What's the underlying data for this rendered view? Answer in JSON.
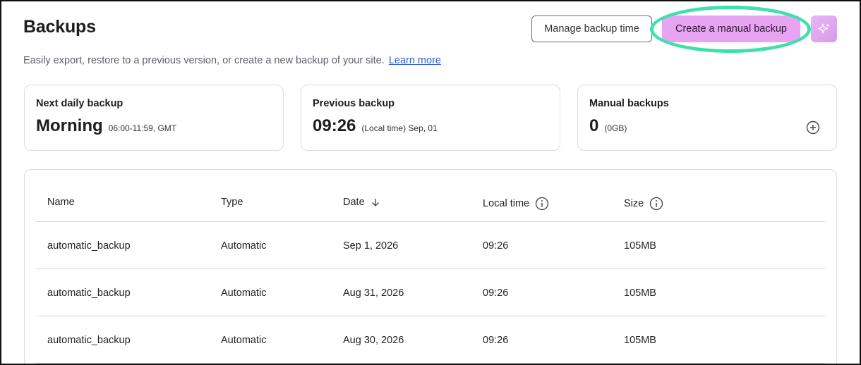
{
  "header": {
    "title": "Backups",
    "subtitle": "Easily export, restore to a previous version, or create a new backup of your site.",
    "learn_more": "Learn more"
  },
  "actions": {
    "manage_label": "Manage backup time",
    "create_label": "Create a manual backup",
    "ai_icon": "sparkles-icon",
    "highlight_color": "#3ee0ad",
    "create_color": "#e7a4f3"
  },
  "cards": {
    "next": {
      "label": "Next daily backup",
      "value": "Morning",
      "detail": "06:00-11:59, GMT"
    },
    "previous": {
      "label": "Previous backup",
      "value": "09:26",
      "detail": "(Local time) Sep, 01"
    },
    "manual": {
      "label": "Manual backups",
      "value": "0",
      "detail": "(0GB)",
      "icon": "plus-circle-icon"
    }
  },
  "table": {
    "headers": {
      "name": "Name",
      "type": "Type",
      "date": "Date",
      "local_time": "Local time",
      "size": "Size"
    },
    "rows": [
      {
        "name": "automatic_backup",
        "type": "Automatic",
        "date": "Sep 1, 2026",
        "time": "09:26",
        "size": "105MB"
      },
      {
        "name": "automatic_backup",
        "type": "Automatic",
        "date": "Aug 31, 2026",
        "time": "09:26",
        "size": "105MB"
      },
      {
        "name": "automatic_backup",
        "type": "Automatic",
        "date": "Aug 30, 2026",
        "time": "09:26",
        "size": "105MB"
      }
    ]
  }
}
